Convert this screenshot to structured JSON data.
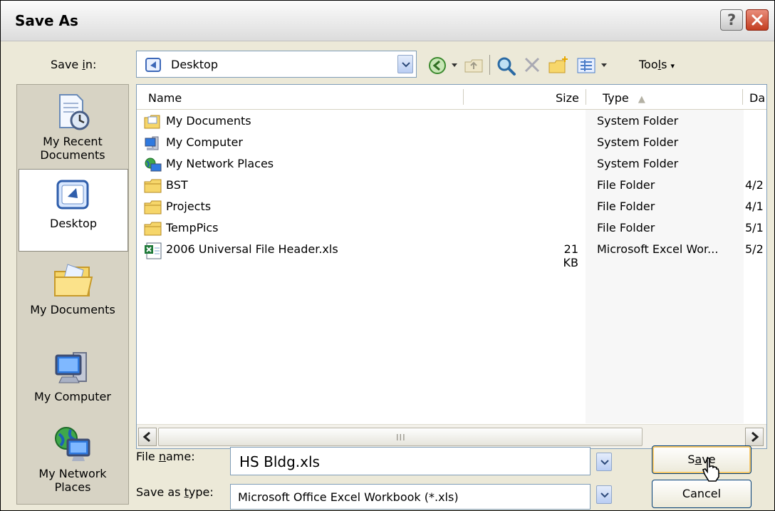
{
  "window": {
    "title": "Save As",
    "help_glyph": "?",
    "close_glyph": "✕"
  },
  "save_in": {
    "label_pre": "Save ",
    "label_key": "i",
    "label_post": "n:",
    "value": "Desktop"
  },
  "toolbar": {
    "icons": [
      "back-icon",
      "dropdown-arrow-icon",
      "up-folder-icon",
      "search-web-icon",
      "delete-icon",
      "new-folder-icon",
      "views-icon",
      "dropdown-arrow-icon"
    ],
    "tools_pre": "Too",
    "tools_key": "l",
    "tools_post": "s",
    "tools_arrow": "▾"
  },
  "places": [
    {
      "label_line1": "My Recent",
      "label_line2": "Documents"
    },
    {
      "label_line1": "Desktop",
      "label_line2": ""
    },
    {
      "label_line1": "My Documents",
      "label_line2": ""
    },
    {
      "label_line1": "My Computer",
      "label_line2": ""
    },
    {
      "label_line1": "My Network",
      "label_line2": "Places"
    }
  ],
  "columns": {
    "name": "Name",
    "size": "Size",
    "type": "Type",
    "sort_arrow": "▲",
    "date": "Da"
  },
  "files": [
    {
      "icon": "my-documents-icon",
      "name": "My Documents",
      "size": "",
      "type": "System Folder",
      "date": ""
    },
    {
      "icon": "my-computer-icon",
      "name": "My Computer",
      "size": "",
      "type": "System Folder",
      "date": ""
    },
    {
      "icon": "network-places-icon",
      "name": "My Network Places",
      "size": "",
      "type": "System Folder",
      "date": ""
    },
    {
      "icon": "folder-icon",
      "name": "BST",
      "size": "",
      "type": "File Folder",
      "date": "4/2"
    },
    {
      "icon": "folder-icon",
      "name": "Projects",
      "size": "",
      "type": "File Folder",
      "date": "4/1"
    },
    {
      "icon": "folder-icon",
      "name": "TempPics",
      "size": "",
      "type": "File Folder",
      "date": "5/1"
    },
    {
      "icon": "excel-file-icon",
      "name": "2006 Universal File Header.xls",
      "size": "21 KB",
      "type": "Microsoft Excel Wor...",
      "date": "5/2"
    }
  ],
  "scroll": {
    "grip": "III"
  },
  "file_name": {
    "label_pre": "File ",
    "label_key": "n",
    "label_post": "ame:",
    "value": "HS Bldg.xls"
  },
  "save_type": {
    "label_pre": "Save as ",
    "label_key": "t",
    "label_post": "ype:",
    "value": "Microsoft Office Excel Workbook (*.xls)"
  },
  "buttons": {
    "save_pre": "S",
    "save_key": "a",
    "save_post": "ve",
    "cancel": "Cancel"
  },
  "colors": {
    "selection_border": "#f6c86a",
    "accent_blue": "#7f9db9",
    "close_red": "#c33d20"
  }
}
